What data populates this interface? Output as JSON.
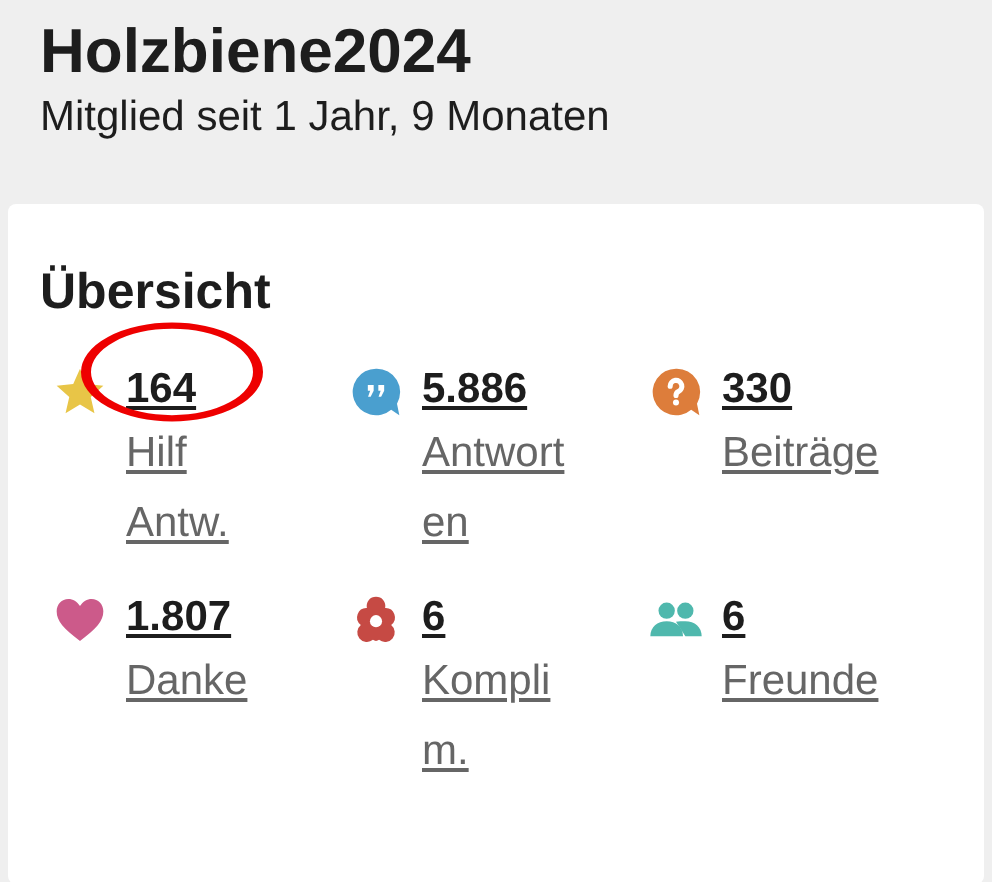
{
  "profile": {
    "name": "Holzbiene2024",
    "member_since": "Mitglied seit 1 Jahr, 9 Monaten"
  },
  "overview": {
    "title": "Übersicht",
    "stats": [
      {
        "kind": "star",
        "color": "#e8c547",
        "value": "164",
        "label": "Hilf Antw.",
        "highlighted": true
      },
      {
        "kind": "quote",
        "color": "#4a9fcf",
        "value": "5.886",
        "label": "Antworten",
        "highlighted": false
      },
      {
        "kind": "question",
        "color": "#dd7d3b",
        "value": "330",
        "label": "Beiträge",
        "highlighted": false
      },
      {
        "kind": "heart",
        "color": "#cc5a8a",
        "value": "1.807",
        "label": "Danke",
        "highlighted": false
      },
      {
        "kind": "flower",
        "color": "#c64a44",
        "value": "6",
        "label": "Komplim.",
        "highlighted": false
      },
      {
        "kind": "people",
        "color": "#4fb8ad",
        "value": "6",
        "label": "Freunde",
        "highlighted": false
      }
    ]
  }
}
